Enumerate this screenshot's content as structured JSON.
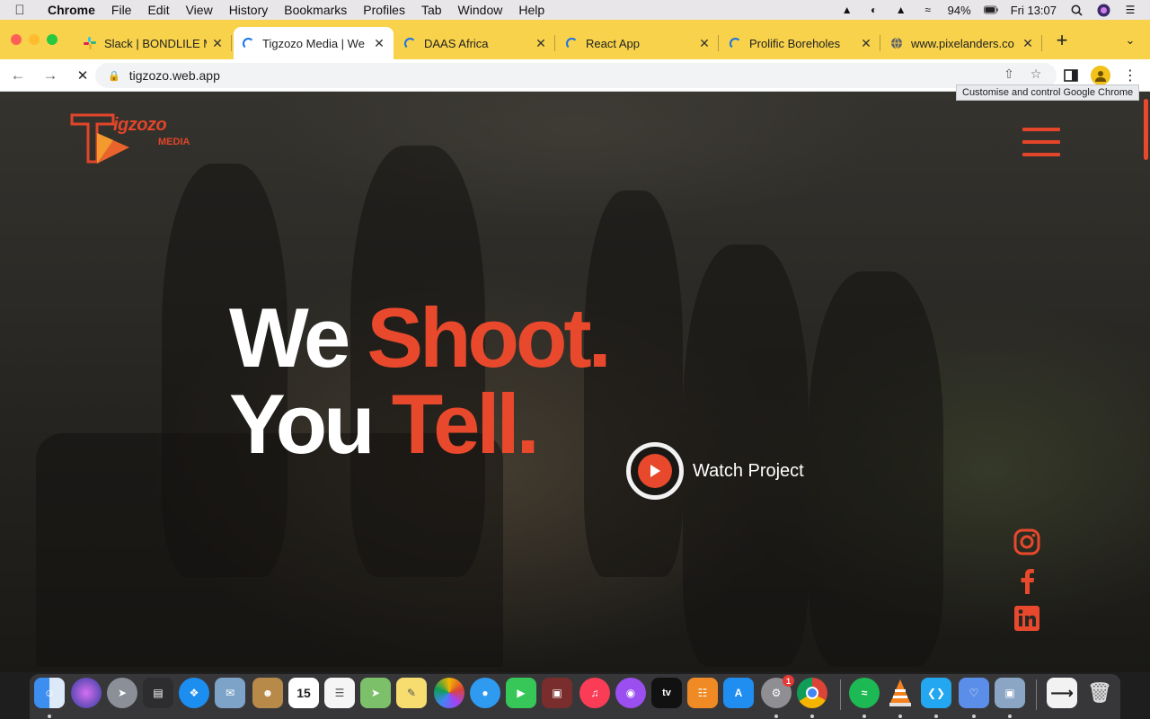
{
  "menubar": {
    "apple_icon": "apple-logo-icon",
    "items": [
      "Chrome",
      "File",
      "Edit",
      "View",
      "History",
      "Bookmarks",
      "Profiles",
      "Tab",
      "Window",
      "Help"
    ],
    "battery": "94%",
    "clock": "Fri 13:07"
  },
  "tabs": [
    {
      "title": "Slack | BONDLILE M",
      "icon": "slack-icon"
    },
    {
      "title": "Tigzozo Media | We",
      "icon": "loading-spinner-icon"
    },
    {
      "title": "DAAS Africa",
      "icon": "loading-spinner-icon"
    },
    {
      "title": "React App",
      "icon": "loading-spinner-icon"
    },
    {
      "title": "Prolific Boreholes",
      "icon": "loading-spinner-icon"
    },
    {
      "title": "www.pixelanders.co",
      "icon": "globe-icon"
    }
  ],
  "toolbar": {
    "url": "tigzozo.web.app",
    "tooltip": "Customise and control Google Chrome"
  },
  "site": {
    "logo_text": "igzozo",
    "logo_sub": "MEDIA",
    "headline_line1_white": "We ",
    "headline_line1_accent": "Shoot.",
    "headline_line2_white": "You ",
    "headline_line2_accent": "Tell.",
    "watch_label": "Watch Project",
    "accent_color": "#e8492c"
  },
  "social": [
    "instagram-icon",
    "facebook-icon",
    "linkedin-icon"
  ],
  "dock": {
    "calendar_day": "15",
    "settings_badge": "1"
  }
}
